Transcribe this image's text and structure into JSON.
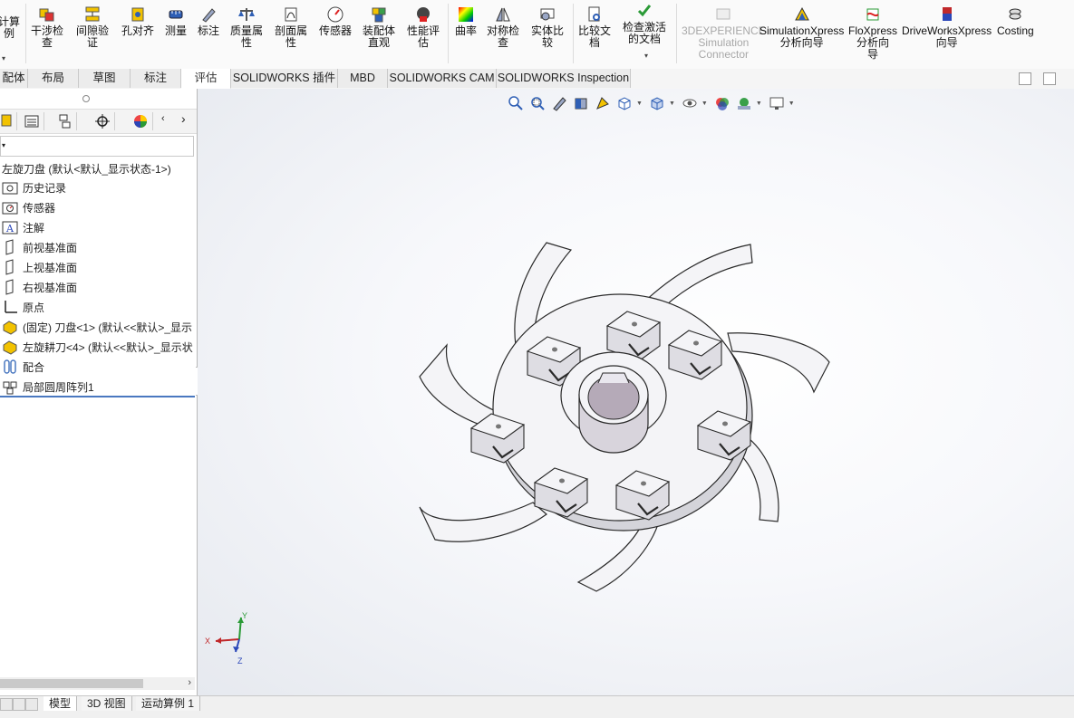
{
  "ribbon": {
    "partial_left_label_1": "计算",
    "partial_left_label_2": "例",
    "buttons": [
      {
        "label1": "干涉检",
        "label2": "查"
      },
      {
        "label1": "间隙验",
        "label2": "证"
      },
      {
        "label1": "孔对齐",
        "label2": ""
      },
      {
        "label1": "测量",
        "label2": ""
      },
      {
        "label1": "标注",
        "label2": ""
      },
      {
        "label1": "质量属",
        "label2": "性"
      },
      {
        "label1": "剖面属",
        "label2": "性"
      },
      {
        "label1": "传感器",
        "label2": ""
      },
      {
        "label1": "装配体",
        "label2": "直观"
      },
      {
        "label1": "性能评",
        "label2": "估"
      },
      {
        "label1": "曲率",
        "label2": ""
      },
      {
        "label1": "对称检",
        "label2": "查"
      },
      {
        "label1": "实体比",
        "label2": "较"
      },
      {
        "label1": "比较文",
        "label2": "档"
      },
      {
        "label1": "检查激活",
        "label2": "的文档"
      },
      {
        "label1": "3DEXPERIENCE",
        "label2": "Simulation",
        "label3": "Connector"
      },
      {
        "label1": "SimulationXpress",
        "label2": "分析向导"
      },
      {
        "label1": "FloXpress",
        "label2": "分析向",
        "label3": "导"
      },
      {
        "label1": "DriveWorksXpress",
        "label2": "向导"
      },
      {
        "label1": "Costing",
        "label2": ""
      }
    ]
  },
  "tabs": [
    {
      "label": "配体"
    },
    {
      "label": "布局"
    },
    {
      "label": "草图"
    },
    {
      "label": "标注"
    },
    {
      "label": "评估"
    },
    {
      "label": "SOLIDWORKS 插件"
    },
    {
      "label": "MBD"
    },
    {
      "label": "SOLIDWORKS CAM"
    },
    {
      "label": "SOLIDWORKS Inspection"
    }
  ],
  "tree": {
    "root": "左旋刀盘 (默认<默认_显示状态-1>)",
    "items": [
      {
        "label": "历史记录"
      },
      {
        "label": "传感器"
      },
      {
        "label": "注解"
      },
      {
        "label": "前视基准面"
      },
      {
        "label": "上视基准面"
      },
      {
        "label": "右视基准面"
      },
      {
        "label": "原点"
      },
      {
        "label": "(固定) 刀盘<1> (默认<<默认>_显示"
      },
      {
        "label": "左旋耕刀<4> (默认<<默认>_显示状"
      },
      {
        "label": "配合"
      },
      {
        "label": "局部圆周阵列1"
      }
    ]
  },
  "triad": {
    "x": "X",
    "y": "Y",
    "z": "Z"
  },
  "bottom_tabs": [
    {
      "label": "模型"
    },
    {
      "label": "3D 视图"
    },
    {
      "label": "运动算例 1"
    }
  ],
  "colors": {
    "accent": "#4a78c0",
    "part_fill": "#f4f4f7",
    "edge": "#2a2a2a",
    "bore": "#b5aab8",
    "axis_x": "#c0282a",
    "axis_y": "#2a9a36",
    "axis_z": "#2a46b8"
  }
}
